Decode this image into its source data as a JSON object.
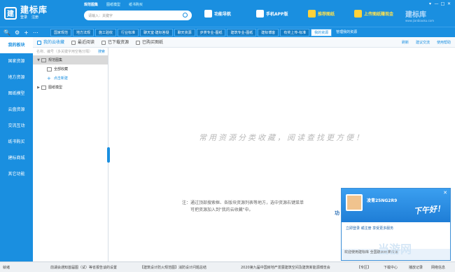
{
  "app": {
    "logo_mark": "建",
    "title": "建标库",
    "login": "登录",
    "register": "注册"
  },
  "search": {
    "tabs": [
      "规范图集",
      "图纸模型",
      "纸书购买"
    ],
    "placeholder": "请输入：关键字"
  },
  "header_buttons": [
    {
      "label": "功能导航"
    },
    {
      "label": "手机APP版"
    },
    {
      "label": "推荐图纸"
    },
    {
      "label": "上传图纸赚现金"
    }
  ],
  "brand_right": {
    "title": "建标库",
    "sub": "www.jianbiaoku.com"
  },
  "window_controls": [
    "▾",
    "—",
    "□",
    "✕"
  ],
  "nav_icons": [
    "🔍",
    "⚙",
    "+",
    "⋯"
  ],
  "nav_tabs": [
    "国家规范",
    "地方法规",
    "施工验收",
    "行业标准",
    "聊天室·建标答疑",
    "聊天资源",
    "步类专业-图纸",
    "建筑专业-图纸",
    "建标博客",
    "有奖上传-标准",
    "我的资源",
    "管理我的资源"
  ],
  "sidebar": [
    "我的板块",
    "国家资源",
    "地方资源",
    "图纸模型",
    "云盘资源",
    "交流互动",
    "纸书购买",
    "建标商城",
    "其它功能"
  ],
  "toolbar": {
    "items": [
      "我的云收藏",
      "最近阅读",
      "已下载资源",
      "已购买图纸"
    ],
    "right": [
      "刷新",
      "建议交流",
      "使用帮助"
    ]
  },
  "tree": {
    "search_placeholder": "名称、编号（多关键字用空格分隔）",
    "search_button": "搜索",
    "nodes": [
      {
        "label": "规范图集"
      },
      {
        "label": "全部收藏"
      },
      {
        "label": "点击新建"
      },
      {
        "label": "图纸模型"
      }
    ]
  },
  "main": {
    "slogan": "常用资源分类收藏，阅读查找更方便！",
    "note_line1": "注：通过顶部搜索框、各版块资源列表等地方，选中资源右键菜单",
    "note_line2": "可把资源加入到\"我的云收藏\"中。",
    "note_link": "功"
  },
  "popup": {
    "user": "凌青25NG2R9",
    "greeting": "下午好！",
    "line": "立即登录 或注册 享受更多服务",
    "bottom": "欢迎使用建标库 全国建筑标准资源"
  },
  "watermark": "当游网",
  "status": {
    "left": "就绪",
    "items": [
      "前湖会通知首届图（试）等省报告谈的设置",
      "【建筑设计防火规范图】消防设计问题总结",
      "2020第九届中国房地产发展建筑空间及建筑新能源博览会"
    ],
    "right": [
      "【专区】",
      "下载中心",
      "播放记录",
      "网络信息"
    ]
  }
}
